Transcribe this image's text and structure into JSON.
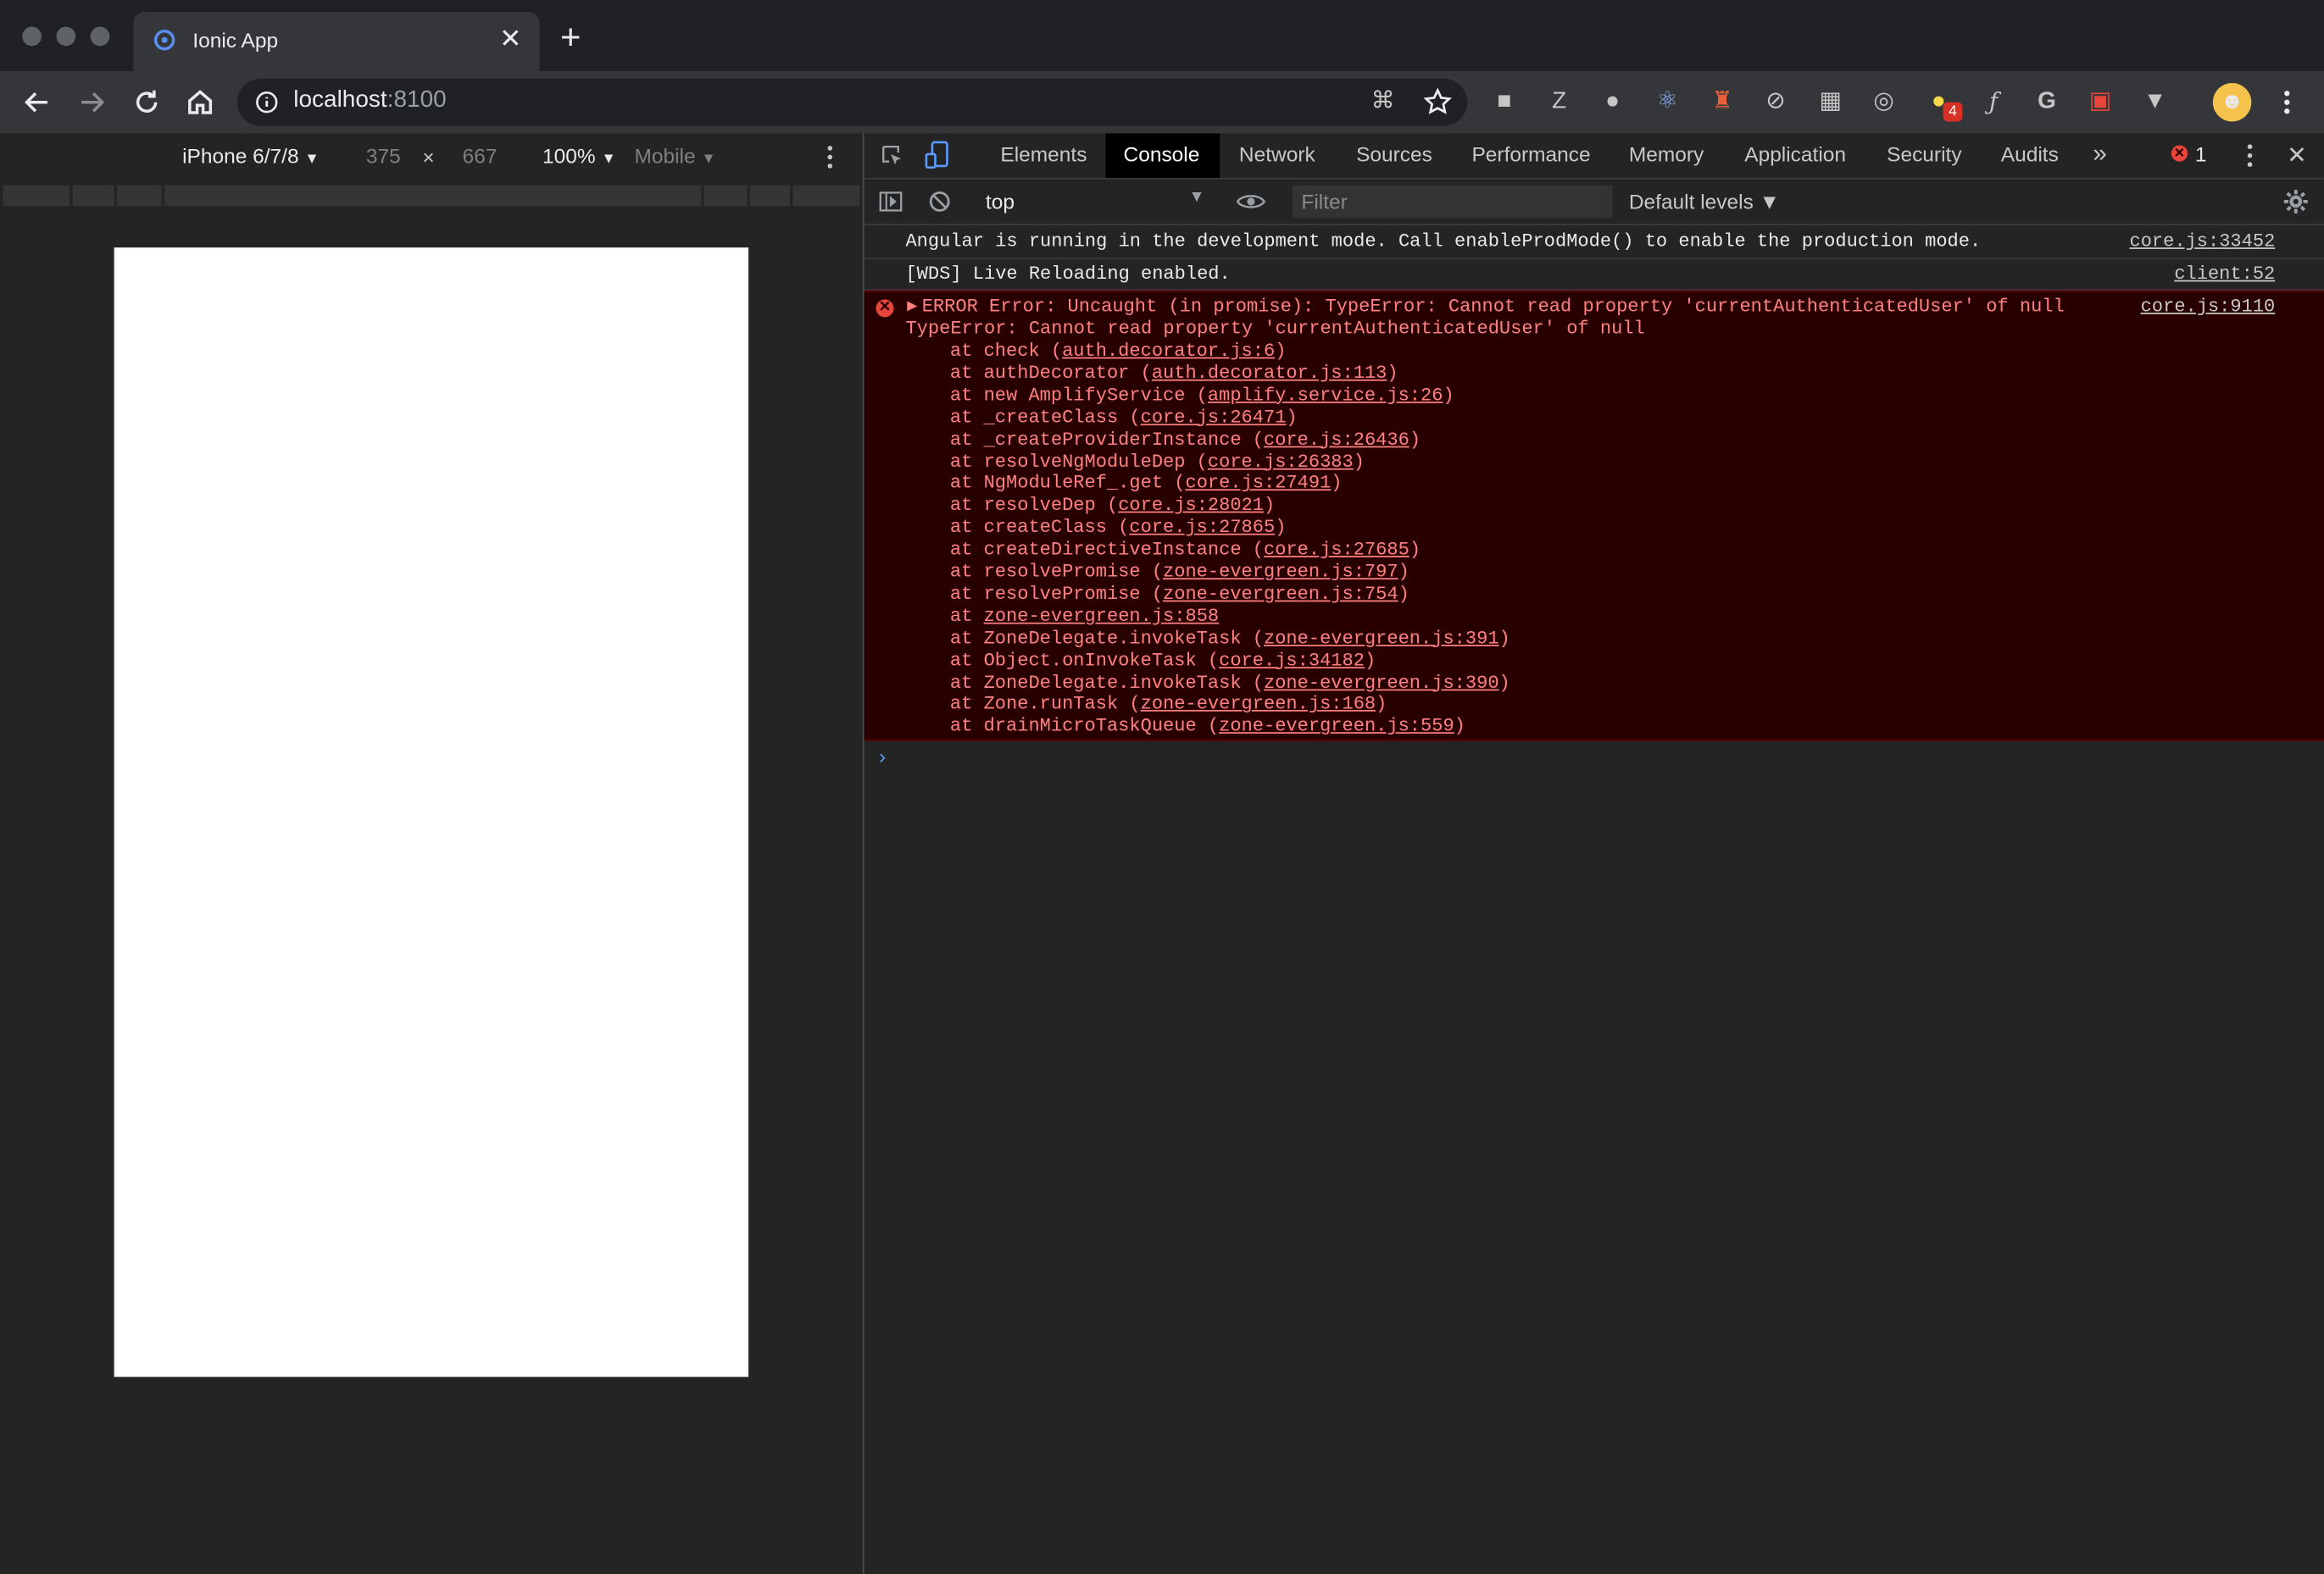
{
  "tab": {
    "title": "Ionic App",
    "close": "✕",
    "new": "+"
  },
  "toolbar": {
    "url_host": "localhost",
    "url_port": ":8100",
    "badge_count": "4"
  },
  "device": {
    "name": "iPhone 6/7/8",
    "width": "375",
    "times": "×",
    "height": "667",
    "zoom": "100%",
    "throttle": "Mobile",
    "caret": "▼"
  },
  "devtools": {
    "tabs": [
      "Elements",
      "Console",
      "Network",
      "Sources",
      "Performance",
      "Memory",
      "Application",
      "Security",
      "Audits"
    ],
    "more": "»",
    "error_count": "1",
    "close": "✕"
  },
  "console_toolbar": {
    "context": "top",
    "filter_placeholder": "Filter",
    "levels": "Default levels ▼"
  },
  "console": {
    "messages": [
      {
        "text": "Angular is running in the development mode. Call enableProdMode() to enable the production mode.",
        "source": "core.js:33452"
      },
      {
        "text": "[WDS] Live Reloading enabled.",
        "source": "client:52"
      }
    ],
    "error": {
      "headline": "ERROR Error: Uncaught (in promise): TypeError: Cannot read property 'currentAuthenticatedUser' of null",
      "source": "core.js:9110",
      "detail": "TypeError: Cannot read property 'currentAuthenticatedUser' of null",
      "stack": [
        {
          "fn": "check",
          "file": "auth.decorator.js:6"
        },
        {
          "fn": "authDecorator",
          "file": "auth.decorator.js:113"
        },
        {
          "fn": "new AmplifyService",
          "file": "amplify.service.js:26"
        },
        {
          "fn": "_createClass",
          "file": "core.js:26471"
        },
        {
          "fn": "_createProviderInstance",
          "file": "core.js:26436"
        },
        {
          "fn": "resolveNgModuleDep",
          "file": "core.js:26383"
        },
        {
          "fn": "NgModuleRef_.get",
          "file": "core.js:27491"
        },
        {
          "fn": "resolveDep",
          "file": "core.js:28021"
        },
        {
          "fn": "createClass",
          "file": "core.js:27865"
        },
        {
          "fn": "createDirectiveInstance",
          "file": "core.js:27685"
        },
        {
          "fn": "resolvePromise",
          "file": "zone-evergreen.js:797"
        },
        {
          "fn": "resolvePromise",
          "file": "zone-evergreen.js:754"
        },
        {
          "fn": "",
          "file": "zone-evergreen.js:858"
        },
        {
          "fn": "ZoneDelegate.invokeTask",
          "file": "zone-evergreen.js:391"
        },
        {
          "fn": "Object.onInvokeTask",
          "file": "core.js:34182"
        },
        {
          "fn": "ZoneDelegate.invokeTask",
          "file": "zone-evergreen.js:390"
        },
        {
          "fn": "Zone.runTask",
          "file": "zone-evergreen.js:168"
        },
        {
          "fn": "drainMicroTaskQueue",
          "file": "zone-evergreen.js:559"
        }
      ]
    },
    "prompt": "›"
  }
}
